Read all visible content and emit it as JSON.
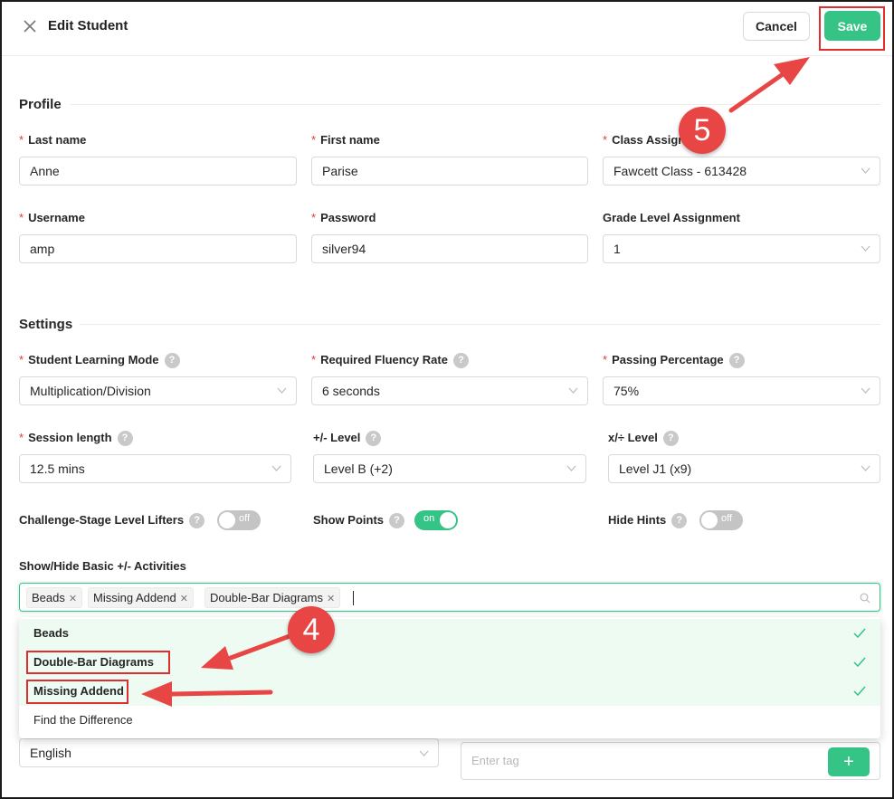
{
  "header": {
    "title": "Edit Student",
    "cancel_label": "Cancel",
    "save_label": "Save"
  },
  "profile": {
    "section_title": "Profile",
    "last_name": {
      "label": "Last name",
      "value": "Anne"
    },
    "first_name": {
      "label": "First name",
      "value": "Parise"
    },
    "class_assignment": {
      "label": "Class Assign",
      "value": "Fawcett Class - 613428"
    },
    "username": {
      "label": "Username",
      "value": "amp"
    },
    "password": {
      "label": "Password",
      "value": "silver94"
    },
    "grade_level": {
      "label": "Grade Level Assignment",
      "value": "1"
    }
  },
  "settings": {
    "section_title": "Settings",
    "learning_mode": {
      "label": "Student Learning Mode",
      "value": "Multiplication/Division"
    },
    "fluency_rate": {
      "label": "Required Fluency Rate",
      "value": "6 seconds"
    },
    "passing_percentage": {
      "label": "Passing Percentage",
      "value": "75%"
    },
    "session_length": {
      "label": "Session length",
      "value": "12.5 mins"
    },
    "plus_minus_level": {
      "label": "+/- Level",
      "value": "Level B (+2)"
    },
    "times_div_level": {
      "label": "x/÷ Level",
      "value": "Level J1 (x9)"
    },
    "level_lifters": {
      "label": "Challenge-Stage Level Lifters",
      "state": "off"
    },
    "show_points": {
      "label": "Show Points",
      "state": "on"
    },
    "hide_hints": {
      "label": "Hide Hints",
      "state": "off"
    },
    "activities": {
      "label": "Show/Hide Basic +/- Activities",
      "tags": [
        "Beads",
        "Missing Addend",
        "Double-Bar Diagrams"
      ],
      "options": [
        {
          "label": "Beads",
          "selected": true
        },
        {
          "label": "Double-Bar Diagrams",
          "selected": true
        },
        {
          "label": "Missing Addend",
          "selected": true
        },
        {
          "label": "Find the Difference",
          "selected": false
        }
      ]
    },
    "language": {
      "value": "English"
    },
    "tag_input": {
      "placeholder": "Enter tag",
      "add_label": "+"
    }
  },
  "annotations": {
    "step4": "4",
    "step5": "5"
  },
  "colors": {
    "accent": "#35c486",
    "required": "#e53935",
    "callout": "#e84545"
  },
  "icons": [
    "close-icon",
    "chevron-down-icon",
    "question-icon",
    "search-icon",
    "check-icon",
    "plus-icon"
  ]
}
